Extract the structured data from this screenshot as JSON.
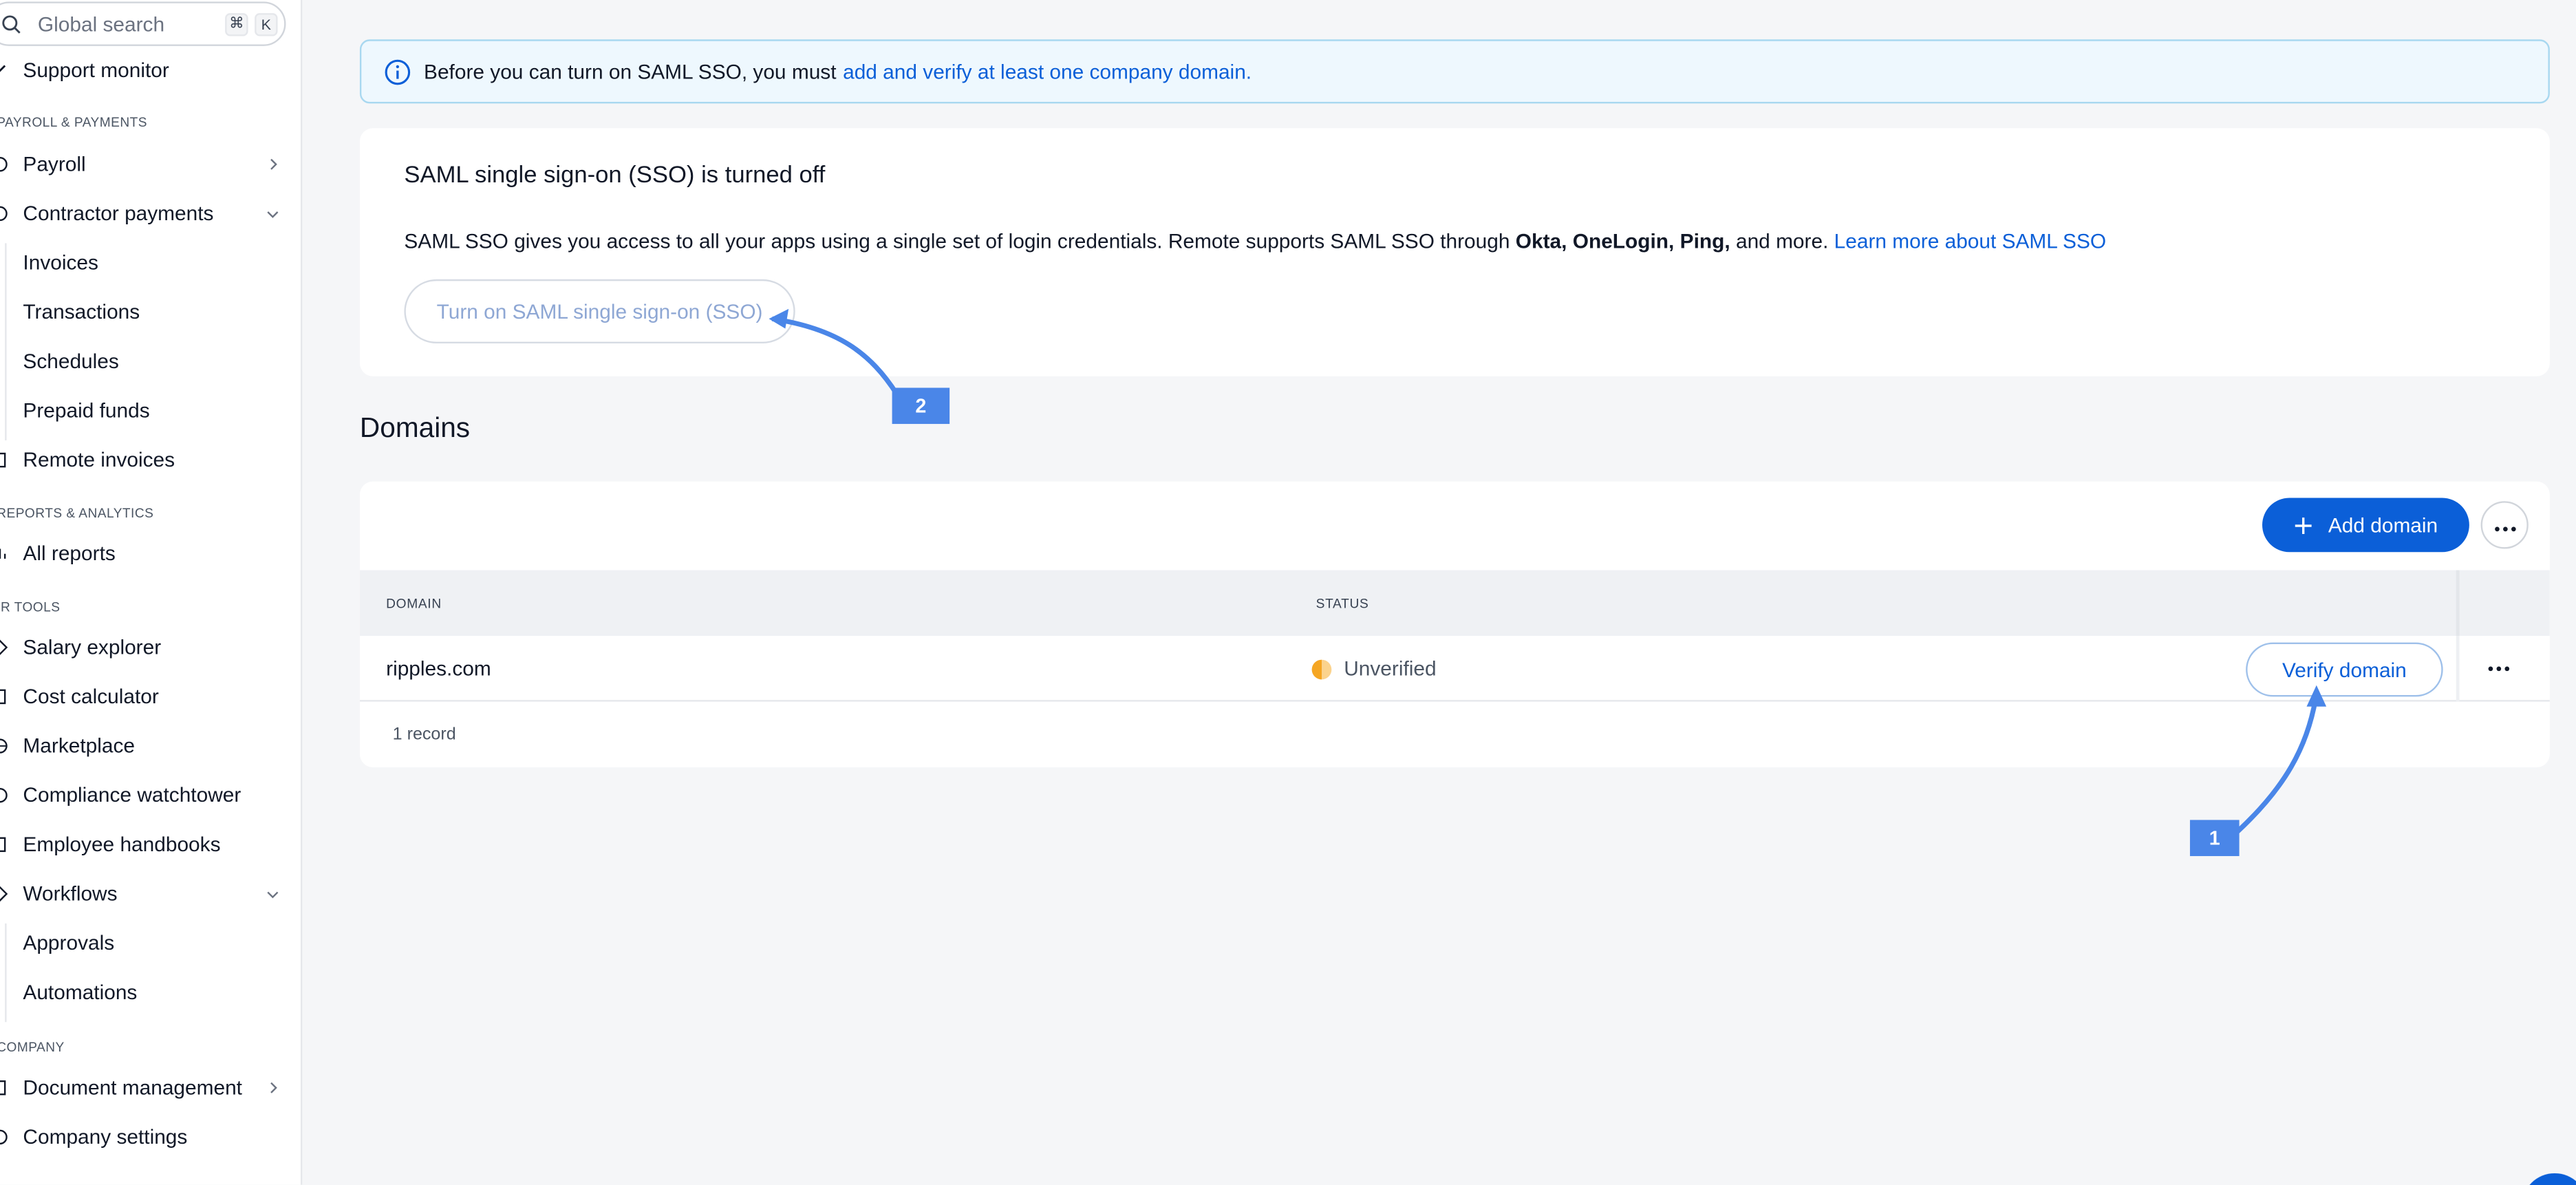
{
  "search": {
    "placeholder": "Global search",
    "shortcut_cmd": "⌘",
    "shortcut_key": "K"
  },
  "sidebar": {
    "top_item": "Support monitor",
    "sections": {
      "payroll": "PAYROLL & PAYMENTS",
      "reports": "REPORTS & ANALYTICS",
      "tools": "OUR TOOLS",
      "company": "COMPANY"
    },
    "items": {
      "payroll": "Payroll",
      "contractor_payments": "Contractor payments",
      "invoices": "Invoices",
      "transactions": "Transactions",
      "schedules": "Schedules",
      "prepaid_funds": "Prepaid funds",
      "remote_invoices": "Remote invoices",
      "all_reports": "All reports",
      "salary_explorer": "Salary explorer",
      "cost_calculator": "Cost calculator",
      "marketplace": "Marketplace",
      "compliance_watchtower": "Compliance watchtower",
      "employee_handbooks": "Employee handbooks",
      "workflows": "Workflows",
      "approvals": "Approvals",
      "automations": "Automations",
      "document_management": "Document management",
      "company_settings": "Company settings"
    }
  },
  "banner": {
    "text": "Before you can turn on SAML SSO, you must",
    "link": "add and verify at least one company domain."
  },
  "sso": {
    "title": "SAML single sign-on (SSO) is turned off",
    "desc_start": "SAML SSO gives you access to all your apps using a single set of login credentials. Remote supports SAML SSO through",
    "okta": "Okta,",
    "onelogin": "OneLogin,",
    "ping": "Ping,",
    "desc_end": "and more.",
    "learn_more": "Learn more about SAML SSO",
    "button": "Turn on SAML single sign-on (SSO)"
  },
  "domains": {
    "heading": "Domains",
    "add_button": "Add domain",
    "columns": {
      "domain": "DOMAIN",
      "status": "STATUS"
    },
    "rows": [
      {
        "domain": "ripples.com",
        "status": "Unverified",
        "action": "Verify domain"
      }
    ],
    "footer": "1 record"
  },
  "annotations": {
    "marker_1": "1",
    "marker_2": "2"
  },
  "colors": {
    "accent": "#0b5fd8",
    "annotation": "#4a86e8",
    "warning": "#f5a623"
  }
}
